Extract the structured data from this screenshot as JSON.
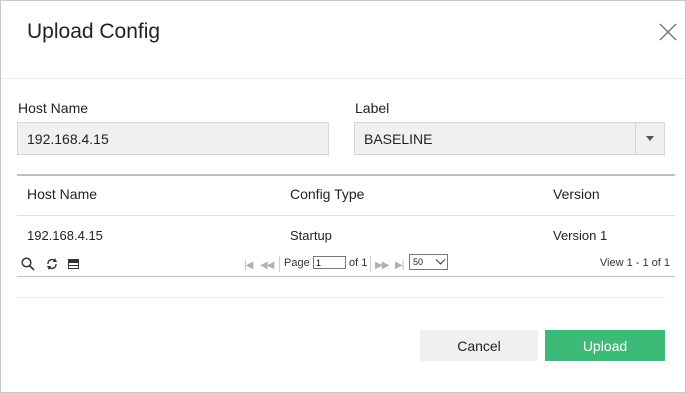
{
  "dialog": {
    "title": "Upload Config"
  },
  "form": {
    "host_name_label": "Host Name",
    "host_name_value": "192.168.4.15",
    "label_label": "Label",
    "label_value": "BASELINE"
  },
  "table": {
    "columns": [
      "Host Name",
      "Config Type",
      "Version"
    ],
    "rows": [
      [
        "192.168.4.15",
        "Startup",
        "Version 1"
      ]
    ]
  },
  "pager": {
    "page_label": "Page",
    "page_value": "1",
    "of_label": "of 1",
    "rows_per_page": "50",
    "view_text": "View 1 - 1 of 1"
  },
  "buttons": {
    "cancel": "Cancel",
    "upload": "Upload"
  },
  "colors": {
    "upload_button": "#3dba78",
    "cancel_button": "#f0f0f0",
    "input_background": "#f0f0f0"
  },
  "icons": {
    "close": "close-icon",
    "search": "search-icon",
    "refresh": "refresh-icon",
    "columns": "columns-icon",
    "first_page": "first-page-icon",
    "prev_page": "prev-page-icon",
    "next_page": "next-page-icon",
    "last_page": "last-page-icon",
    "dropdown": "chevron-down-icon"
  }
}
